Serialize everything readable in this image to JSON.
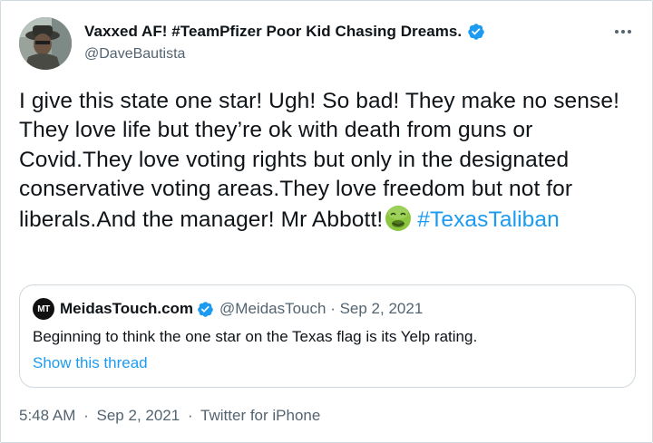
{
  "author": {
    "display_name": "Vaxxed AF! #TeamPfizer Poor Kid Chasing Dreams.",
    "handle": "@DaveBautista",
    "verified_color": "#1d9bf0"
  },
  "tweet": {
    "text": "I give this state one star! Ugh! So bad! They make no sense! They love life but they’re ok with death from guns or Covid.They love voting rights but only in the designated conservative voting areas.They love freedom but not for liberals.And the manager! Mr Abbott!",
    "emoji": "nauseated-face-emoji",
    "hashtag": "#TexasTaliban"
  },
  "quote": {
    "logo_text": "MT",
    "name": "MeidasTouch.com",
    "meta": "@MeidasTouch · Sep 2, 2021",
    "text": "Beginning to think the one star on the Texas flag is its Yelp rating.",
    "link": "Show this thread"
  },
  "footer": {
    "time": "5:48 AM",
    "date": "Sep 2, 2021",
    "source": "Twitter for iPhone",
    "separator": "·"
  },
  "colors": {
    "accent": "#1d9bf0",
    "secondary_text": "#536471",
    "border": "#cfd9de"
  }
}
